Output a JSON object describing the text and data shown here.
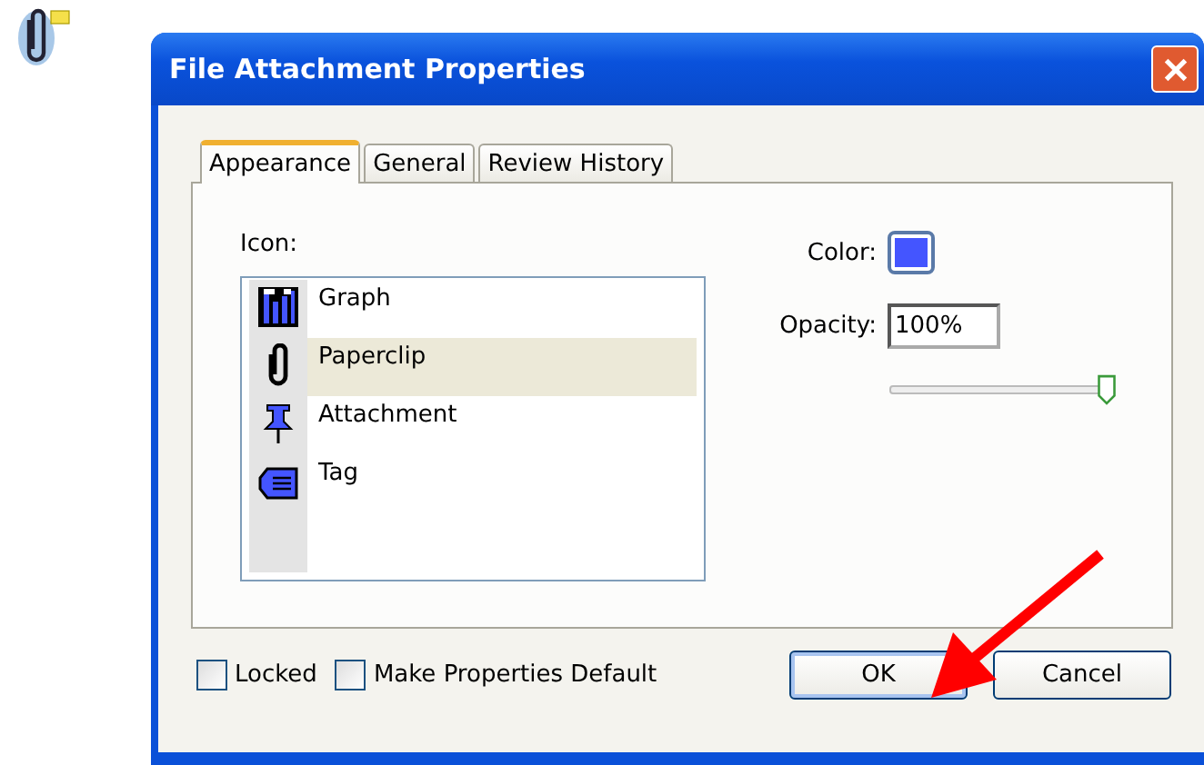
{
  "window": {
    "title": "File Attachment Properties"
  },
  "tabs": [
    {
      "label": "Appearance",
      "selected": true
    },
    {
      "label": "General",
      "selected": false
    },
    {
      "label": "Review History",
      "selected": false
    }
  ],
  "icon_label": "Icon:",
  "icons": [
    {
      "label": "Graph",
      "kind": "graph",
      "selected": false
    },
    {
      "label": "Paperclip",
      "kind": "paperclip",
      "selected": true
    },
    {
      "label": "Attachment",
      "kind": "pushpin",
      "selected": false
    },
    {
      "label": "Tag",
      "kind": "tag",
      "selected": false
    }
  ],
  "color": {
    "label": "Color:",
    "color": "#4455ff"
  },
  "opacity": {
    "label": "Opacity:",
    "value": "100%",
    "level": 0.98
  },
  "checkboxes": [
    {
      "label": "Locked",
      "checked": false
    },
    {
      "label": "Make Properties Default",
      "checked": false
    }
  ],
  "buttons": [
    "OK",
    "Cancel"
  ]
}
